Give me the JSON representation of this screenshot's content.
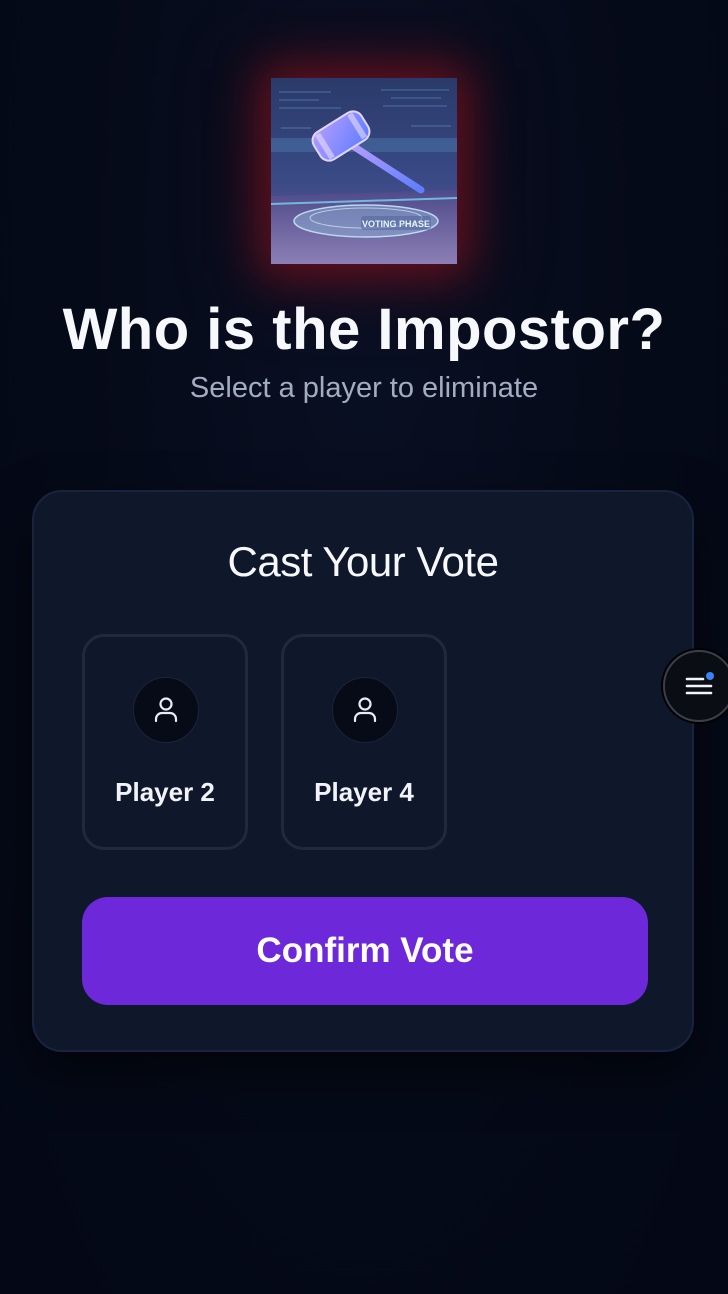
{
  "hero": {
    "image_icon": "gavel-voting-phase-illustration",
    "image_caption": "VOTING PHASE"
  },
  "header": {
    "title": "Who is the Impostor?",
    "subtitle": "Select a player to eliminate"
  },
  "vote_card": {
    "title": "Cast Your Vote",
    "players": [
      {
        "name": "Player 2",
        "icon": "user-icon"
      },
      {
        "name": "Player 4",
        "icon": "user-icon"
      }
    ],
    "confirm_label": "Confirm Vote"
  },
  "floating_menu": {
    "icon": "menu-icon",
    "notification_dot": true
  },
  "colors": {
    "background": "#050a18",
    "card": "#0f172a",
    "accent": "#6d28d9",
    "hero_glow": "#a0141e",
    "notification": "#3b82f6"
  }
}
